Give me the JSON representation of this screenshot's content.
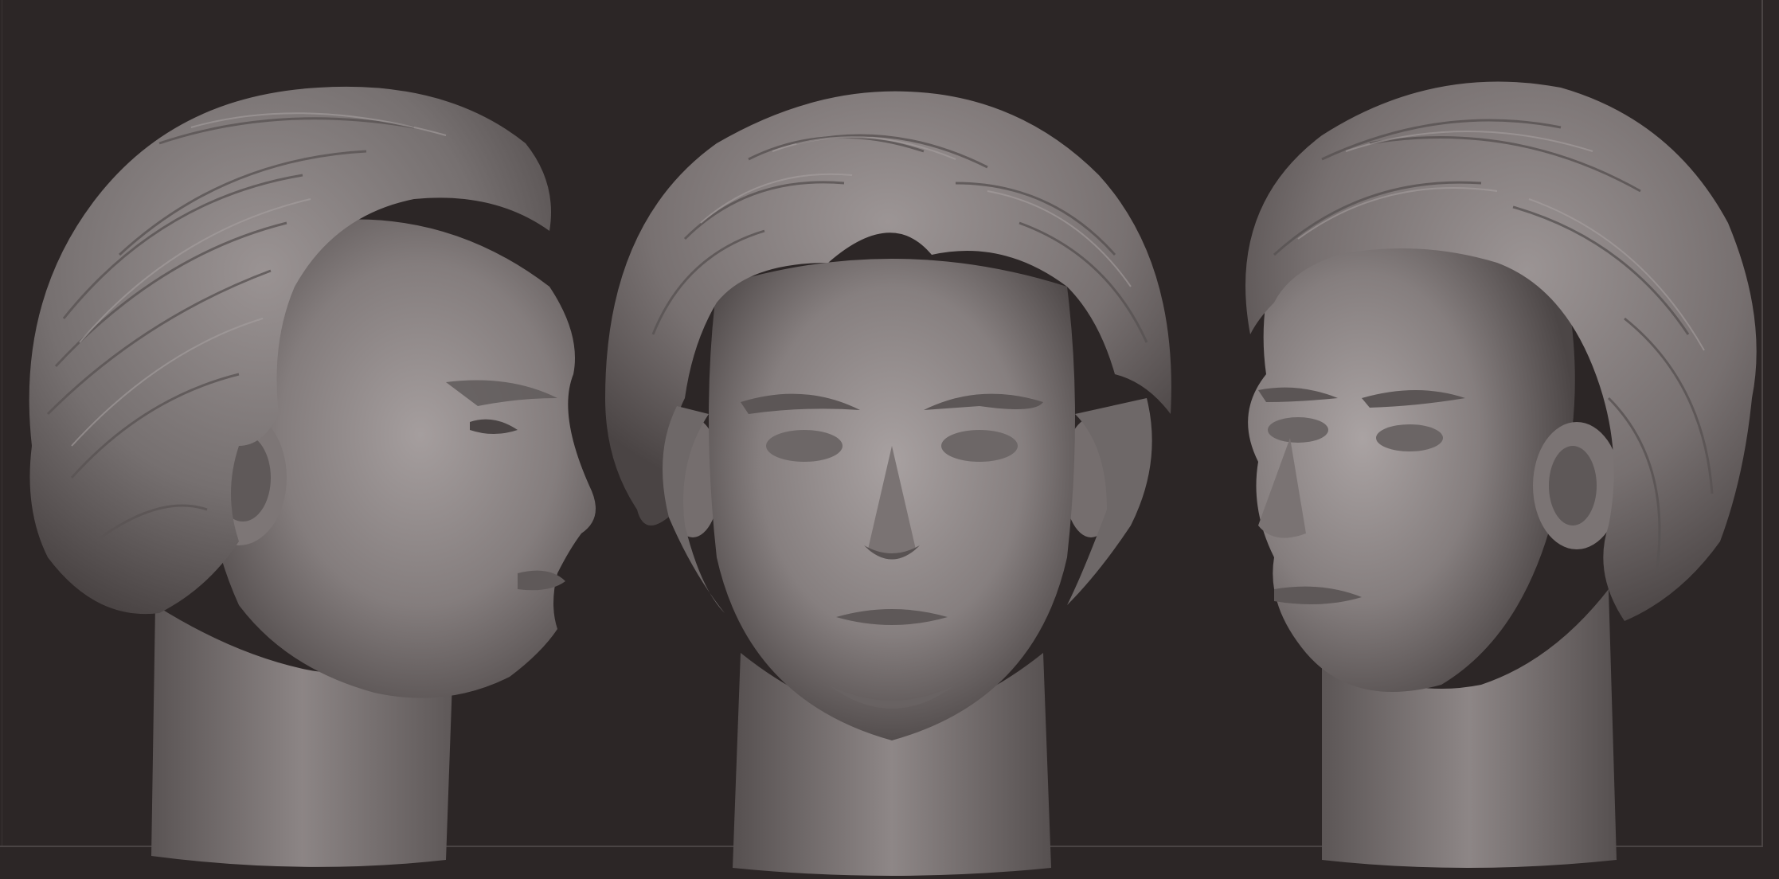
{
  "viewport": {
    "background": "#2c2626",
    "frame_color": "#4a4444"
  },
  "sculpts": [
    {
      "view": "side-profile-right-facing",
      "material": "matcap-gray",
      "color": "#8a8383"
    },
    {
      "view": "front",
      "material": "matcap-gray",
      "color": "#8a8383"
    },
    {
      "view": "three-quarter-left-facing",
      "material": "matcap-gray",
      "color": "#8a8383"
    }
  ]
}
